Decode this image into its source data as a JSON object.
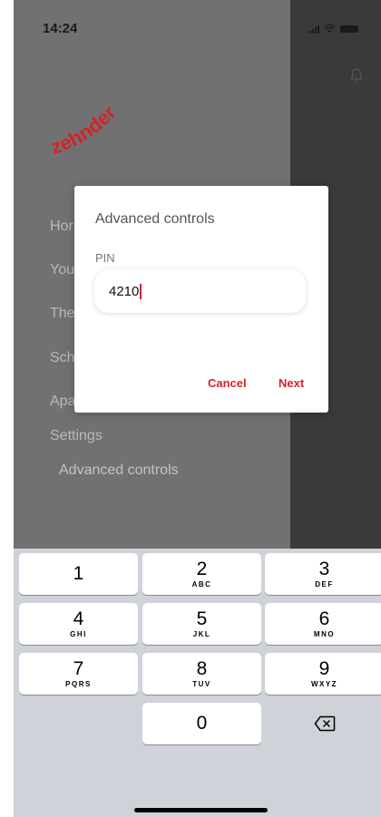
{
  "status_bar": {
    "time": "14:24"
  },
  "brand": {
    "logo_text": "zehnder",
    "color": "#d3232a"
  },
  "menu": {
    "items": [
      "Hor",
      "You",
      "The",
      "Sch",
      "Apa",
      "Settings"
    ],
    "sub_item": "Advanced controls"
  },
  "dialog": {
    "title": "Advanced controls",
    "pin_label": "PIN",
    "pin_value": "4210",
    "cancel_label": "Cancel",
    "next_label": "Next"
  },
  "keypad": {
    "keys": [
      {
        "num": "1",
        "letters": ""
      },
      {
        "num": "2",
        "letters": "ABC"
      },
      {
        "num": "3",
        "letters": "DEF"
      },
      {
        "num": "4",
        "letters": "GHI"
      },
      {
        "num": "5",
        "letters": "JKL"
      },
      {
        "num": "6",
        "letters": "MNO"
      },
      {
        "num": "7",
        "letters": "PQRS"
      },
      {
        "num": "8",
        "letters": "TUV"
      },
      {
        "num": "9",
        "letters": "WXYZ"
      },
      {
        "num": "0",
        "letters": ""
      }
    ],
    "backspace_icon": "backspace-icon"
  }
}
